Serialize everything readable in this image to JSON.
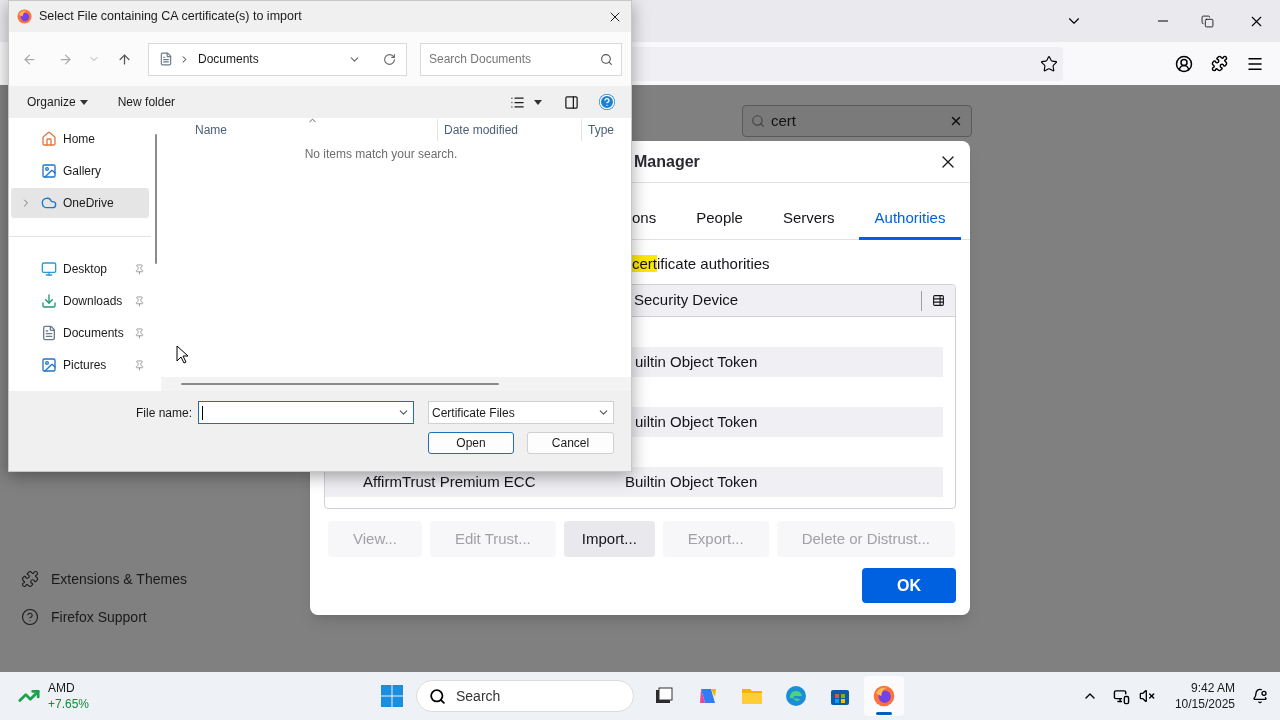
{
  "browser": {
    "page": {
      "search": {
        "value": "cert"
      },
      "links": [
        {
          "label": "Extensions & Themes"
        },
        {
          "label": "Firefox Support"
        }
      ]
    }
  },
  "certificate_manager": {
    "title": "Manager",
    "tabs": [
      {
        "label": "ons",
        "selected": false
      },
      {
        "label": "People",
        "selected": false
      },
      {
        "label": "Servers",
        "selected": false
      },
      {
        "label": "Authorities",
        "selected": true
      }
    ],
    "description": {
      "match": "cert",
      "rest": "ificate authorities"
    },
    "table": {
      "columns": [
        "Security Device"
      ],
      "rows": [
        {
          "device": "uiltin Object Token"
        },
        {
          "device": "uiltin Object Token"
        },
        {
          "name": "AffirmTrust Premium ECC",
          "device": "Builtin Object Token"
        }
      ]
    },
    "buttons": [
      {
        "label": "View...",
        "disabled": true
      },
      {
        "label": "Edit Trust...",
        "disabled": true
      },
      {
        "label": "Import...",
        "disabled": false
      },
      {
        "label": "Export...",
        "disabled": true
      },
      {
        "label": "Delete or Distrust...",
        "disabled": true
      }
    ],
    "ok": "OK"
  },
  "file_dialog": {
    "title": "Select File containing CA certificate(s) to import",
    "path": "Documents",
    "search_placeholder": "Search Documents",
    "commands": [
      "Organize",
      "New folder"
    ],
    "sidebar": [
      [
        {
          "label": "Home",
          "selected": false,
          "expandable": false,
          "pinned": false
        },
        {
          "label": "Gallery",
          "selected": false,
          "expandable": false,
          "pinned": false
        },
        {
          "label": "OneDrive",
          "selected": true,
          "expandable": true,
          "pinned": false
        }
      ],
      [
        {
          "label": "Desktop",
          "selected": false,
          "expandable": false,
          "pinned": true
        },
        {
          "label": "Downloads",
          "selected": false,
          "expandable": false,
          "pinned": true
        },
        {
          "label": "Documents",
          "selected": false,
          "expandable": false,
          "pinned": true
        },
        {
          "label": "Pictures",
          "selected": false,
          "expandable": false,
          "pinned": true
        }
      ]
    ],
    "columns": [
      "Name",
      "Date modified",
      "Type"
    ],
    "empty_message": "No items match your search.",
    "file_name_label": "File name:",
    "file_type": "Certificate Files",
    "buttons": [
      "Open",
      "Cancel"
    ]
  },
  "taskbar": {
    "widget": {
      "symbol": "AMD",
      "change": "+7.65%"
    },
    "search_placeholder": "Search",
    "apps": [
      {
        "selected": false
      },
      {
        "selected": false
      },
      {
        "selected": false
      },
      {
        "selected": false
      },
      {
        "selected": false
      },
      {
        "selected": true
      }
    ],
    "time": "9:42 AM",
    "date": "10/15/2025"
  }
}
